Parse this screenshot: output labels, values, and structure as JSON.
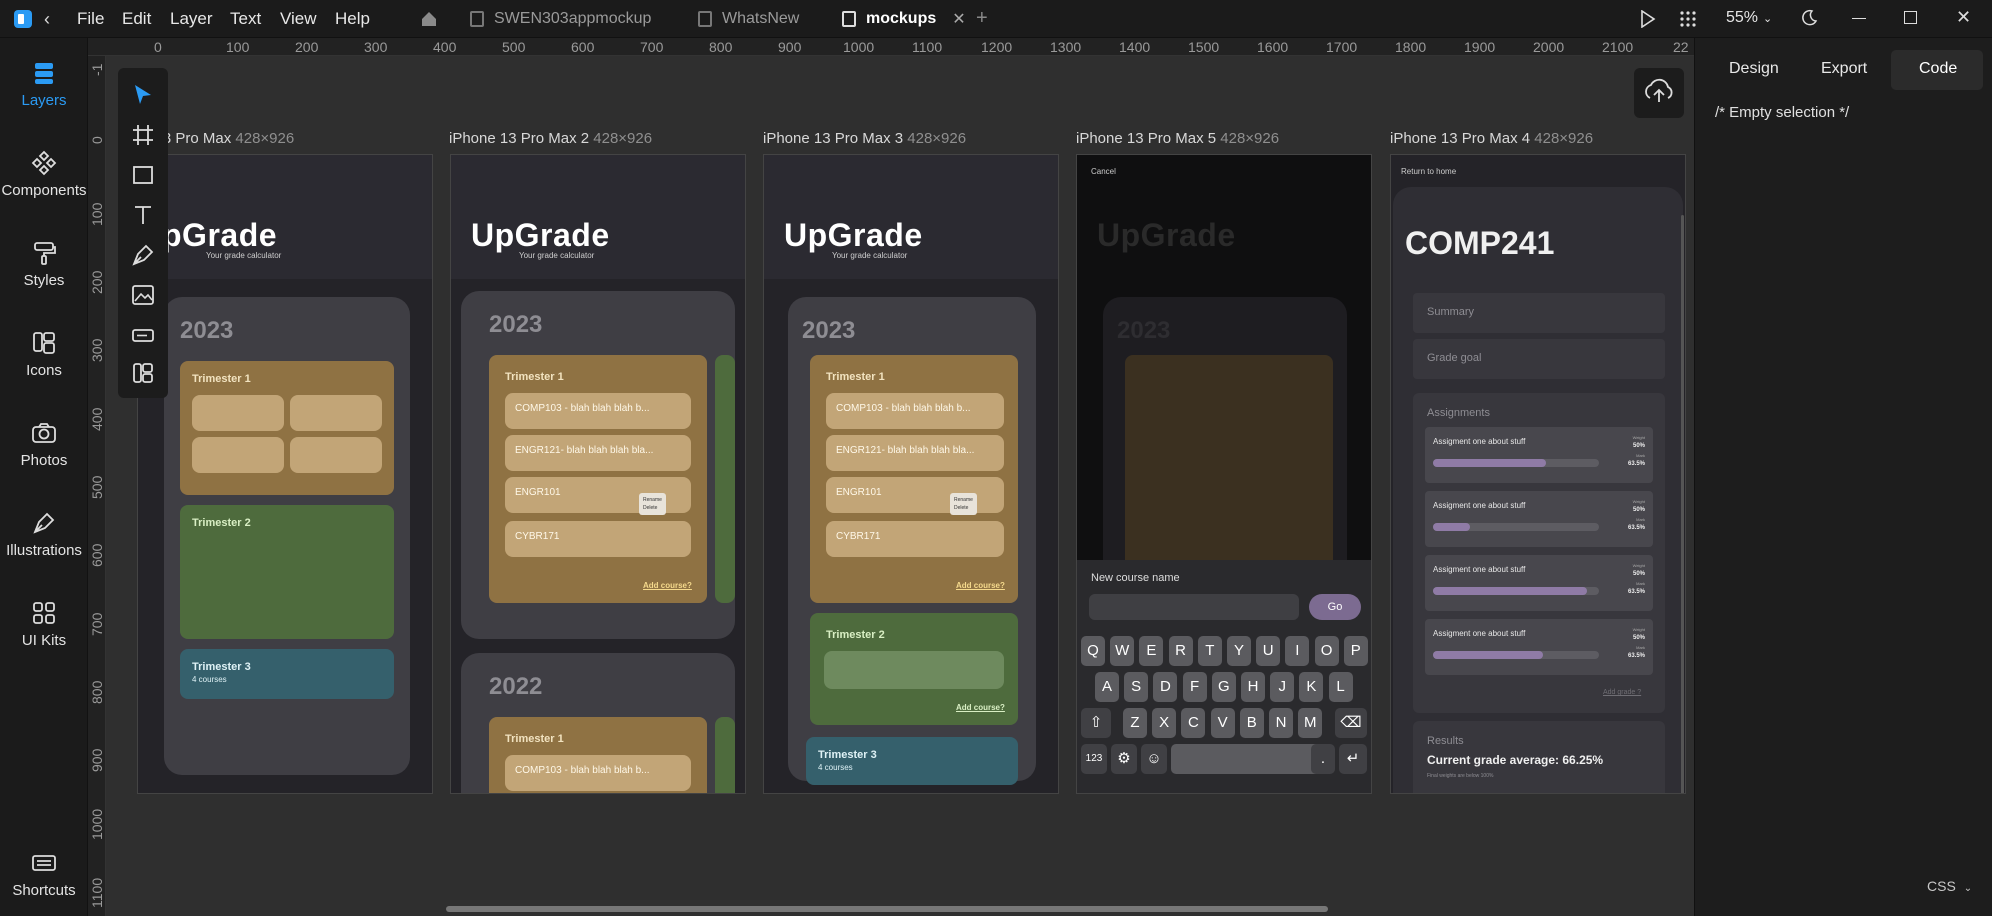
{
  "menu": [
    "File",
    "Edit",
    "Layer",
    "Text",
    "View",
    "Help"
  ],
  "tabs": [
    {
      "label": "SWEN303appmockup"
    },
    {
      "label": "WhatsNew"
    },
    {
      "label": "mockups",
      "active": true
    }
  ],
  "zoom": "55%",
  "leftnav": [
    "Layers",
    "Components",
    "Styles",
    "Icons",
    "Photos",
    "Illustrations",
    "UI Kits"
  ],
  "shortcuts_label": "Shortcuts",
  "ruler_top": [
    "0",
    "100",
    "200",
    "300",
    "400",
    "500",
    "600",
    "700",
    "800",
    "900",
    "1000",
    "1100",
    "1200",
    "1300",
    "1400",
    "1500",
    "1600",
    "1700",
    "1800",
    "1900",
    "2000",
    "2100",
    "22"
  ],
  "ruler_left": [
    "-1",
    "0",
    "100",
    "200",
    "300",
    "400",
    "500",
    "600",
    "700",
    "800",
    "900",
    "1000",
    "1100"
  ],
  "frames": [
    {
      "name": "iPhone 13 Pro Max",
      "size": "428×926"
    },
    {
      "name": "iPhone 13 Pro Max 2",
      "size": "428×926"
    },
    {
      "name": "iPhone 13 Pro Max 3",
      "size": "428×926"
    },
    {
      "name": "iPhone 13 Pro Max 5",
      "size": "428×926"
    },
    {
      "name": "iPhone 13 Pro Max 4",
      "size": "428×926"
    }
  ],
  "frame1_label": "e 13 Pro Max",
  "app": {
    "logo": "UpGrade",
    "logo_cropped": "pGrade",
    "tagline": "Your grade calculator",
    "year_2023": "2023",
    "year_2022": "2022",
    "trimester1": "Trimester 1",
    "trimester2": "Trimester 2",
    "trimester3": "Trimester 3",
    "tri3_courses": "4 courses",
    "courses": [
      "COMP103 - blah blah blah b...",
      "ENGR121- blah blah blah bla...",
      "ENGR101",
      "CYBR171"
    ],
    "add_course": "Add course?",
    "rename": "Rename",
    "delete": "Delete",
    "cancel": "Cancel",
    "new_course_name": "New course name",
    "go": "Go",
    "kb_row1": [
      "Q",
      "W",
      "E",
      "R",
      "T",
      "Y",
      "U",
      "I",
      "O",
      "P"
    ],
    "kb_row2": [
      "A",
      "S",
      "D",
      "F",
      "G",
      "H",
      "J",
      "K",
      "L"
    ],
    "kb_row3": [
      "Z",
      "X",
      "C",
      "V",
      "B",
      "N",
      "M"
    ],
    "kb_123": "123",
    "kb_dot": ".",
    "return_home": "Return to home",
    "course_title": "COMP241",
    "summary": "Summary",
    "grade_goal": "Grade goal",
    "assignments": "Assignments",
    "assignment_name": "Assigment one about stuff",
    "weight_label": "Weight",
    "weight_value": "50%",
    "mark_label": "Mark",
    "mark_value": "63.5%",
    "add_grade": "Add grade ?",
    "results": "Results",
    "current_avg": "Current grade average: 66.25%",
    "final_note": "Final weights are below 100%"
  },
  "progress": [
    0.68,
    0.22,
    0.93,
    0.66
  ],
  "right": {
    "tabs": [
      "Design",
      "Export",
      "Code"
    ],
    "code_text": "/* Empty selection */",
    "lang": "CSS"
  }
}
